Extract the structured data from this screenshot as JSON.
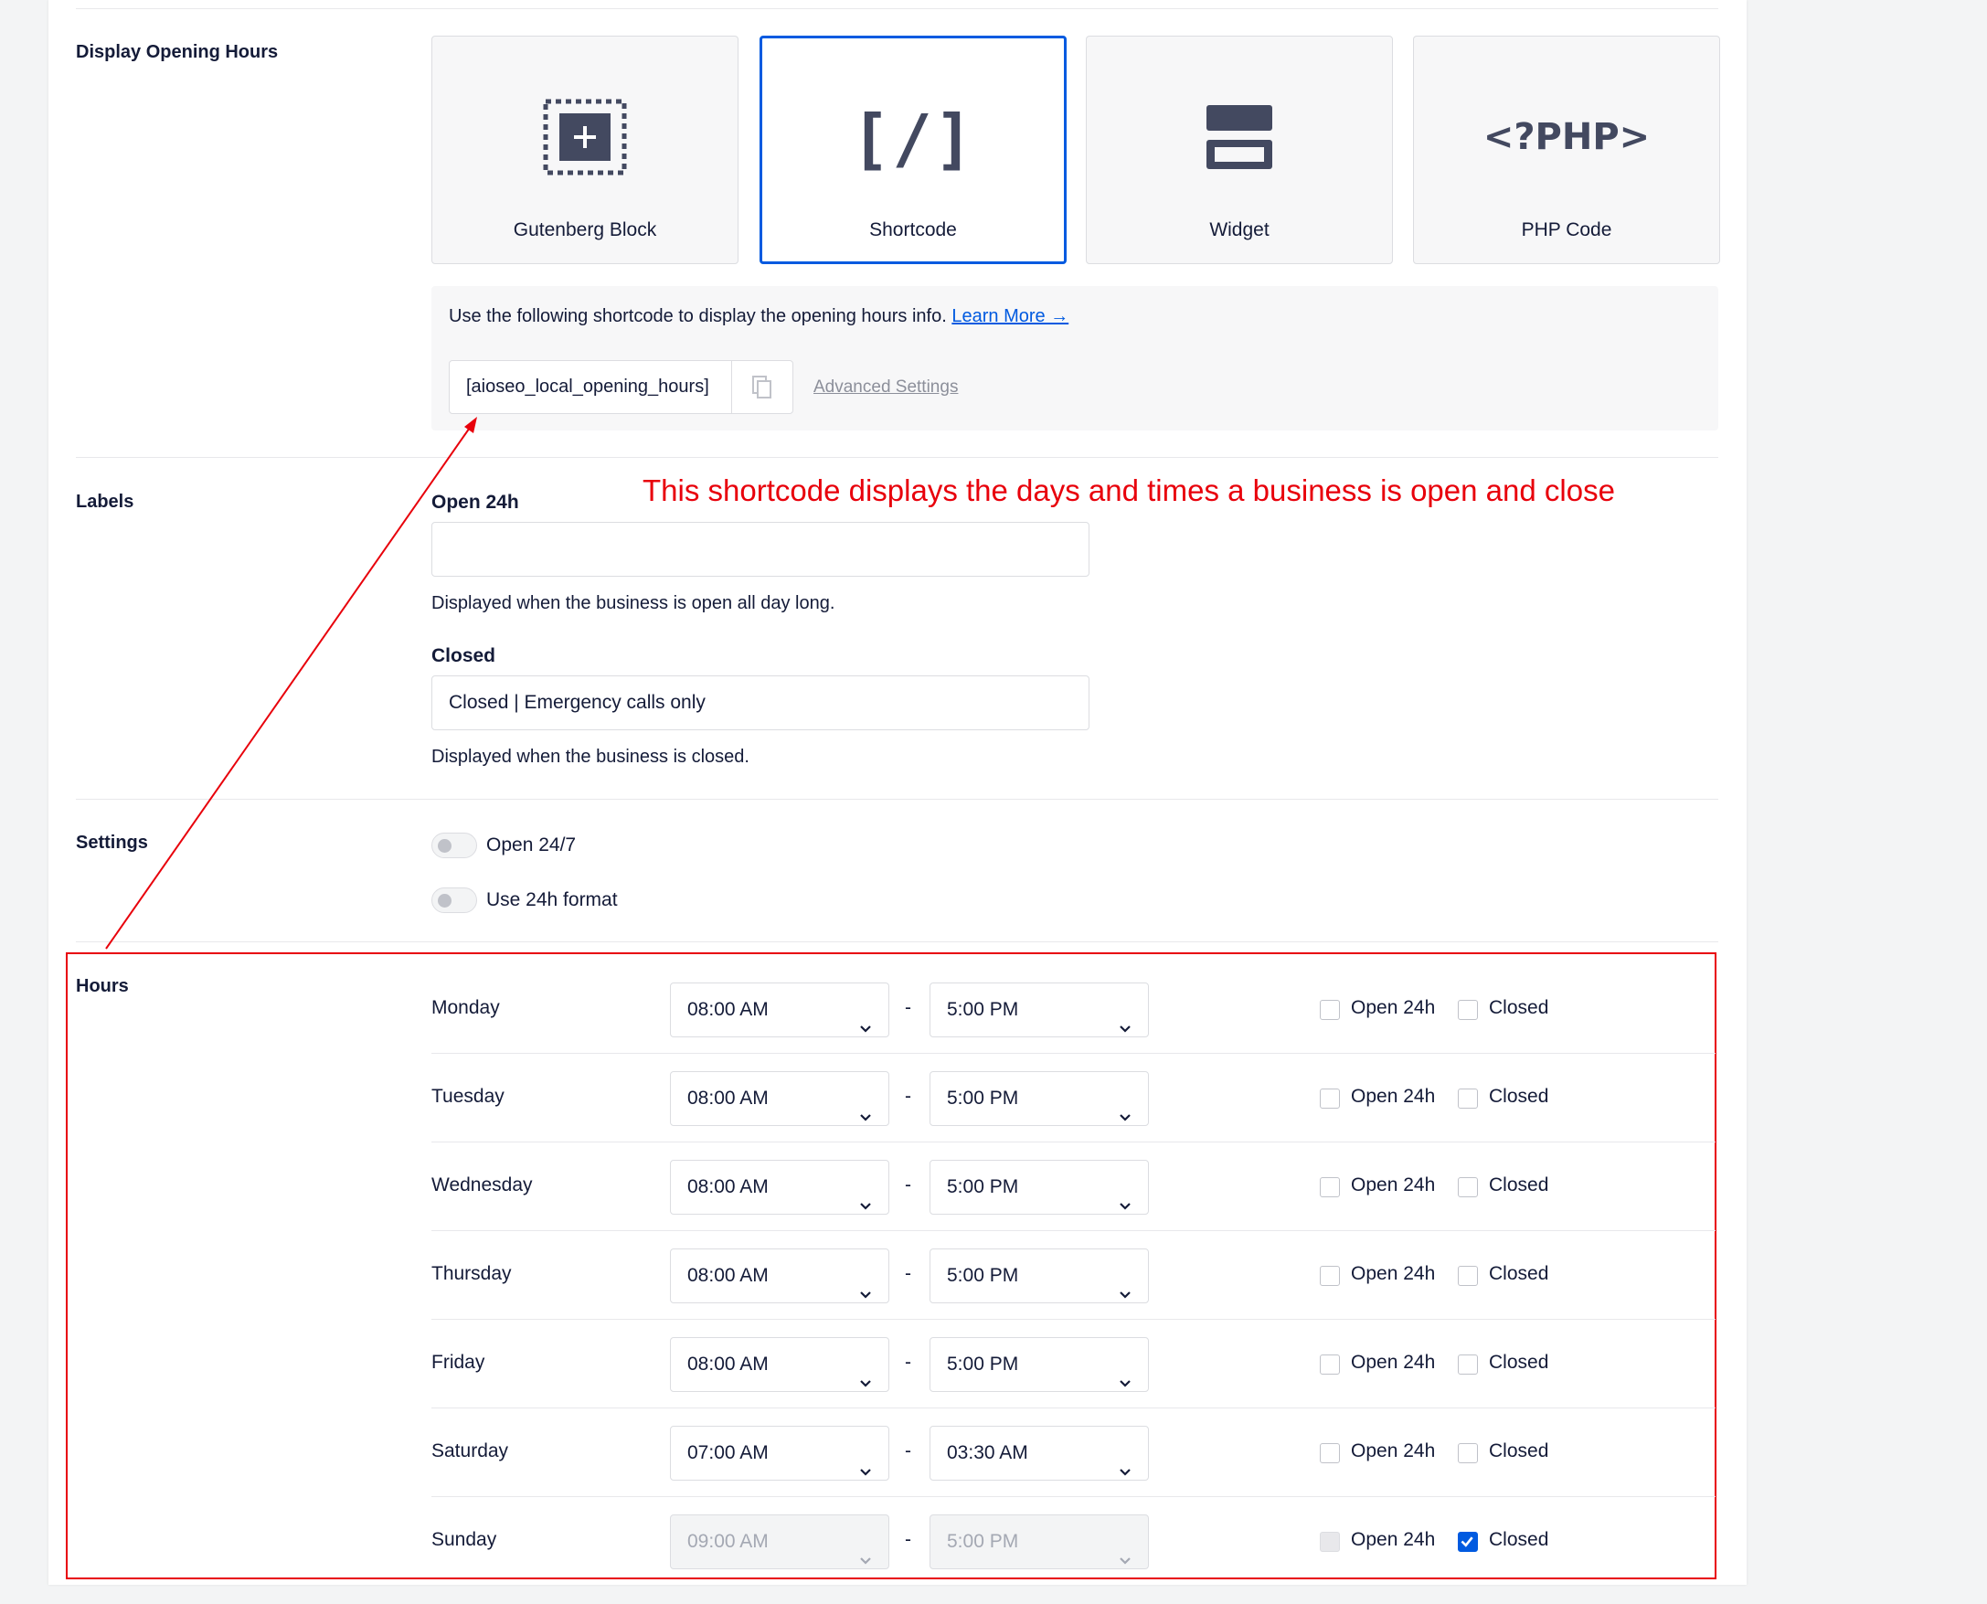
{
  "display": {
    "section_label": "Display Opening Hours",
    "options": [
      {
        "label": "Gutenberg Block",
        "icon": "gutenberg-block-icon"
      },
      {
        "label": "Shortcode",
        "icon": "shortcode-icon",
        "icon_text": "[/]"
      },
      {
        "label": "Widget",
        "icon": "widget-icon"
      },
      {
        "label": "PHP Code",
        "icon": "php-code-icon",
        "icon_text": "<?PHP>"
      }
    ],
    "selected": "Shortcode",
    "info_text": "Use the following shortcode to display the opening hours info.",
    "learn_more": "Learn More →",
    "shortcode": "[aioseo_local_opening_hours]",
    "advanced_settings": "Advanced Settings"
  },
  "labels": {
    "section_label": "Labels",
    "open24_label": "Open 24h",
    "open24_value": "",
    "open24_help": "Displayed when the business is open all day long.",
    "closed_label": "Closed",
    "closed_value": "Closed | Emergency calls only",
    "closed_help": "Displayed when the business is closed."
  },
  "annotation": {
    "text": "This shortcode displays the days and times a business is open and close",
    "color": "#e8000b"
  },
  "settings": {
    "section_label": "Settings",
    "open247_label": "Open 24/7",
    "open247_on": false,
    "format24_label": "Use 24h format",
    "format24_on": false
  },
  "hours": {
    "section_label": "Hours",
    "open24_label": "Open 24h",
    "closed_label": "Closed",
    "separator": "-",
    "days": [
      {
        "day": "Monday",
        "open": "08:00 AM",
        "close": "5:00 PM",
        "open24": false,
        "closed": false
      },
      {
        "day": "Tuesday",
        "open": "08:00 AM",
        "close": "5:00 PM",
        "open24": false,
        "closed": false
      },
      {
        "day": "Wednesday",
        "open": "08:00 AM",
        "close": "5:00 PM",
        "open24": false,
        "closed": false
      },
      {
        "day": "Thursday",
        "open": "08:00 AM",
        "close": "5:00 PM",
        "open24": false,
        "closed": false
      },
      {
        "day": "Friday",
        "open": "08:00 AM",
        "close": "5:00 PM",
        "open24": false,
        "closed": false
      },
      {
        "day": "Saturday",
        "open": "07:00 AM",
        "close": "03:30 AM",
        "open24": false,
        "closed": false
      },
      {
        "day": "Sunday",
        "open": "09:00 AM",
        "close": "5:00 PM",
        "open24": false,
        "closed": true
      }
    ]
  },
  "colors": {
    "accent": "#005ae0",
    "text": "#141b38",
    "border": "#dcdde1",
    "annotation": "#e8000b"
  }
}
